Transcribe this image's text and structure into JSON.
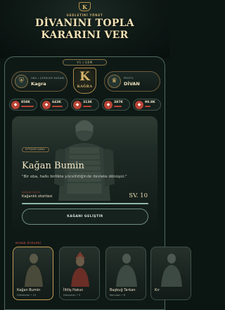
{
  "header": {
    "crest_letter": "K",
    "tagline": "GEDLETİNİ YÖNET",
    "title_line1": "DİVANINI TOPLA",
    "title_line2": "KARARINI VER"
  },
  "version_label": "V1 | GEM",
  "player": {
    "left": {
      "label": "OBA / ÇERKUSE KAĞANI",
      "value": "Kagra"
    },
    "emblem": {
      "letter": "K",
      "word": "KAĞRA"
    },
    "right": {
      "label": "PROFİL",
      "value": "DİVAN"
    }
  },
  "resources": [
    {
      "value": "858K",
      "fill": 0.9,
      "color": "#b94435"
    },
    {
      "value": "643K",
      "fill": 0.75,
      "color": "#b94435"
    },
    {
      "value": "313K",
      "fill": 0.6,
      "color": "#b94435"
    },
    {
      "value": "387K",
      "fill": 0.55,
      "color": "#b94435"
    },
    {
      "value": "90.8K",
      "fill": 0.4,
      "color": "#b94435"
    }
  ],
  "hero": {
    "tag": "İHTİŞAM ŞANLI",
    "name": "Kağan Bumin",
    "quote": "\"Bir oba, halkı birlikte yücelildiğinde devlete dönüşür.\"",
    "stat_label": "KAĞAN GÜCÜ",
    "stat_value": "Kağanlık otoritesi",
    "level": "SV. 10",
    "progress": 1.0,
    "button_label": "KAĞANI GELİŞTİR"
  },
  "roster": {
    "title": "DİVAN ÜYELERİ",
    "cards": [
      {
        "name": "Kağan Bumin",
        "sub": "Hükümdar • 10",
        "selected": true
      },
      {
        "name": "İltiliş Hatun",
        "sub": "Danışman • 5",
        "selected": false
      },
      {
        "name": "Başbuğ Tarkan",
        "sub": "Komutan • 8",
        "selected": false
      },
      {
        "name": "Kır",
        "sub": "",
        "selected": false
      }
    ]
  }
}
